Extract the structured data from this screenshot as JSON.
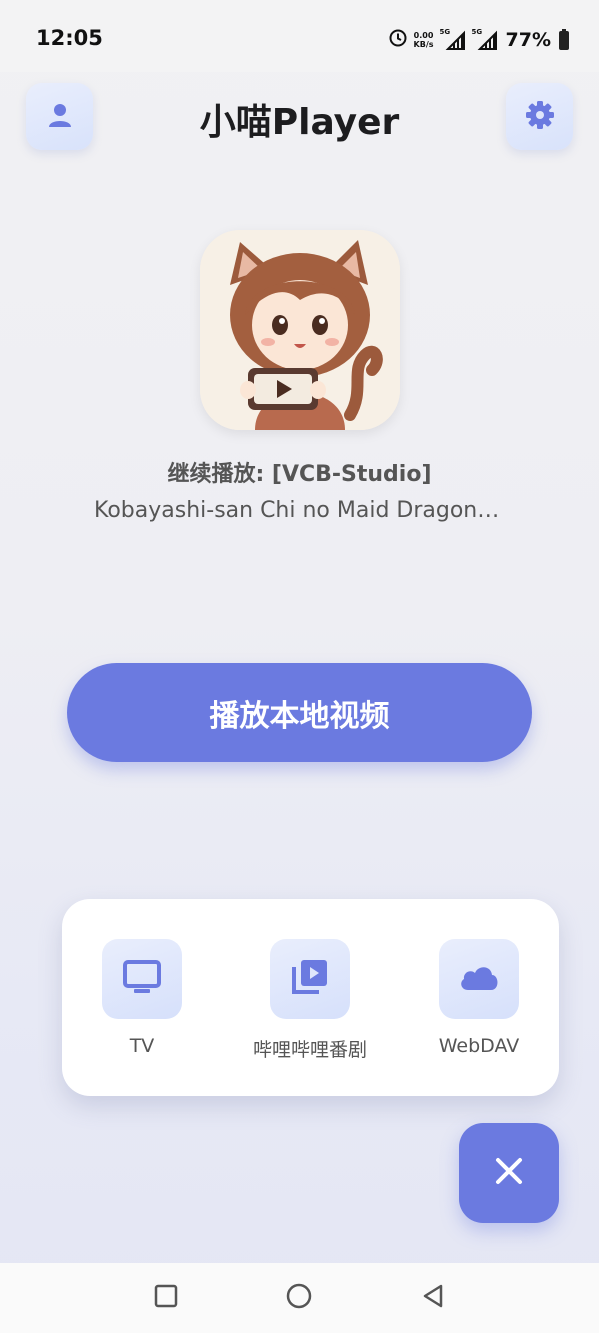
{
  "status_bar": {
    "time": "12:05",
    "net_speed_value": "0.00",
    "net_speed_unit": "KB/s",
    "signal1_tag": "5G",
    "signal2_tag": "5G",
    "battery": "77%",
    "icons": [
      "alarm-icon",
      "signal-icon",
      "signal-icon",
      "battery-icon"
    ]
  },
  "header": {
    "title": "小喵Player",
    "left_icon": "person-icon",
    "right_icon": "gear-icon"
  },
  "resume": {
    "label": "继续播放: [VCB-Studio]",
    "title": "Kobayashi-san Chi no Maid Dragon [ ..."
  },
  "main_button": {
    "label": "播放本地视频"
  },
  "sources": [
    {
      "label": "TV",
      "icon": "tv-icon"
    },
    {
      "label": "哔哩哔哩番剧",
      "icon": "video-library-icon"
    },
    {
      "label": "WebDAV",
      "icon": "cloud-icon"
    }
  ],
  "fab": {
    "icon": "close-icon"
  },
  "nav": {
    "icons": [
      "recents-icon",
      "home-icon",
      "back-icon"
    ]
  },
  "colors": {
    "accent": "#6b7ae0",
    "icon_bg": "#dfe6fb",
    "icon": "#6b7ae0"
  }
}
